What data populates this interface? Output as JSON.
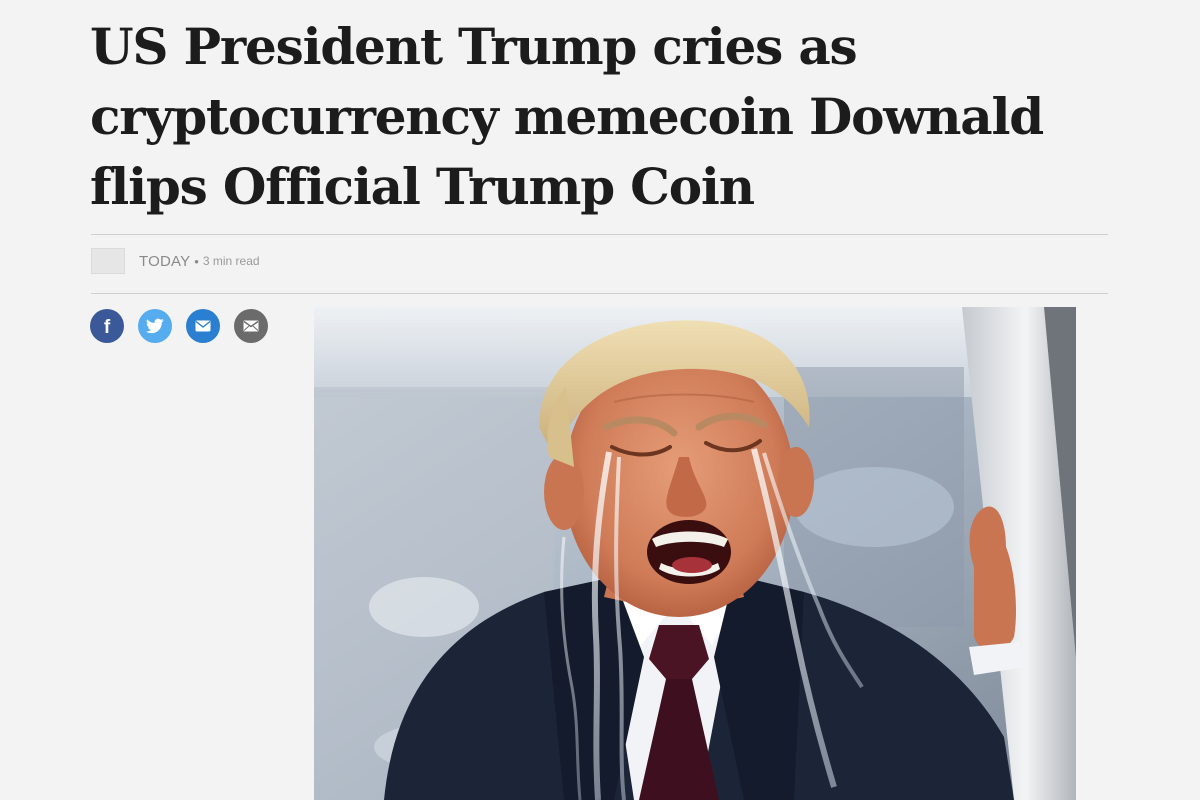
{
  "article": {
    "headline": "US President Trump cries as cryptocurrency memecoin Downald flips Official Trump Coin",
    "byline": {
      "source": "TODAY",
      "separator": "•",
      "read_time": "3 min read"
    }
  },
  "share": [
    {
      "name": "facebook-icon"
    },
    {
      "name": "twitter-icon"
    },
    {
      "name": "message-icon"
    },
    {
      "name": "email-icon"
    }
  ],
  "colors": {
    "facebook": "#3b5998",
    "twitter": "#55acee",
    "message": "#2a7fd0",
    "email": "#6b6b6b"
  }
}
